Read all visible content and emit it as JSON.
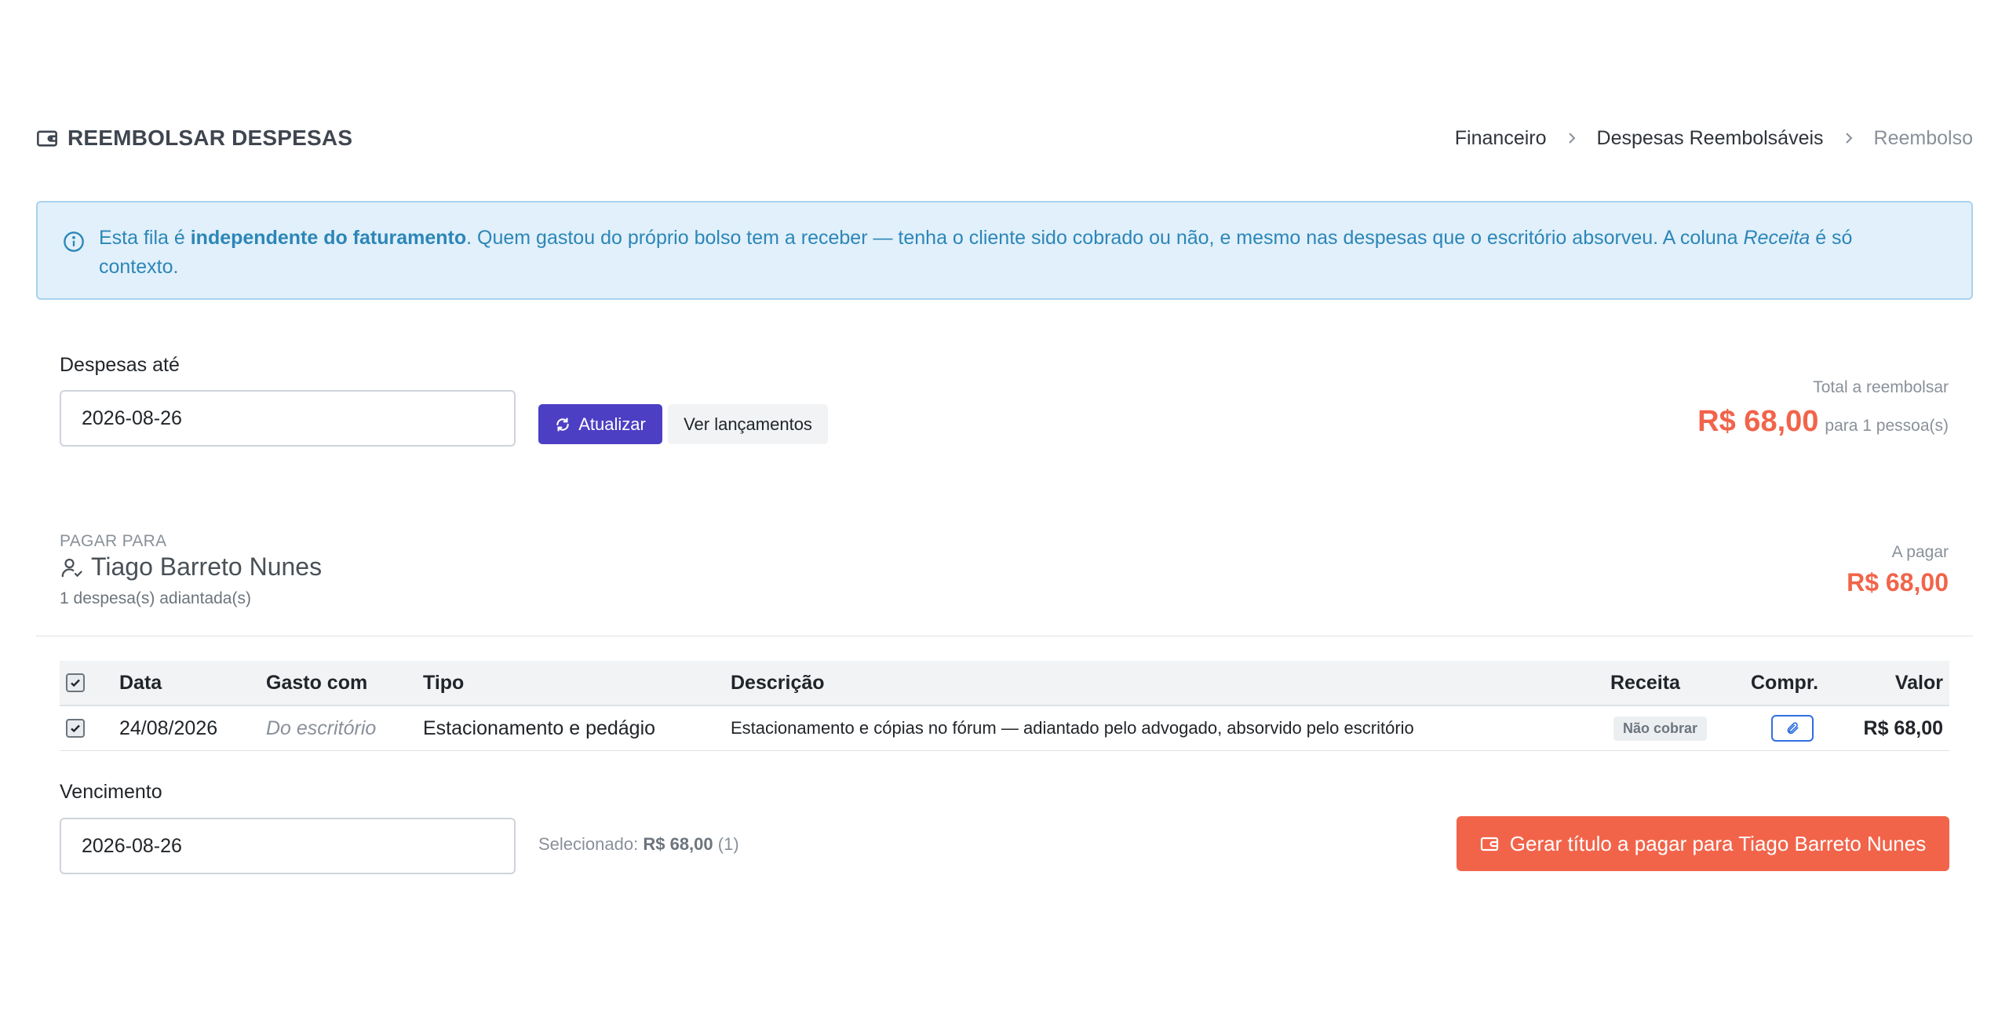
{
  "header": {
    "icon": "wallet-icon",
    "title": "REEMBOLSAR DESPESAS",
    "breadcrumb": [
      "Financeiro",
      "Despesas Reembolsáveis",
      "Reembolso"
    ]
  },
  "alert": {
    "icon": "info-icon",
    "text_1": "Esta fila é ",
    "strong": "independente do faturamento",
    "text_2": ". Quem gastou do próprio bolso tem a receber — tenha o cliente sido cobrado ou não, e mesmo nas despesas que o escritório absorveu. A coluna ",
    "em": "Receita",
    "text_3": " é só contexto."
  },
  "filter": {
    "label": "Despesas até",
    "date_value": "2026-08-26",
    "refresh_label": "Atualizar",
    "view_label": "Ver lançamentos"
  },
  "summary": {
    "total_label": "Total a reembolsar",
    "total_value": "R$ 68,00",
    "people_text": "para 1 pessoa(s)"
  },
  "payee": {
    "pay_to_label": "PAGAR PARA",
    "name": "Tiago Barreto Nunes",
    "count_text": "1 despesa(s) adiantada(s)",
    "to_pay_label": "A pagar",
    "to_pay_value": "R$ 68,00"
  },
  "table": {
    "columns": {
      "data": "Data",
      "gasto_com": "Gasto com",
      "tipo": "Tipo",
      "descricao": "Descrição",
      "receita": "Receita",
      "compr": "Compr.",
      "valor": "Valor"
    },
    "header_checked": true,
    "rows": [
      {
        "checked": true,
        "data": "24/08/2026",
        "gasto_com": "Do escritório",
        "tipo": "Estacionamento e pedágio",
        "descricao": "Estacionamento e cópias no fórum — adiantado pelo advogado, absorvido pelo escritório",
        "receita": "Não cobrar",
        "compr_icon": "paperclip-icon",
        "valor": "R$ 68,00"
      }
    ]
  },
  "footer": {
    "due_label": "Vencimento",
    "due_value": "2026-08-26",
    "selected_label": "Selecionado:",
    "selected_value": "R$ 68,00",
    "selected_count": "(1)",
    "generate_label": "Gerar título a pagar para Tiago Barreto Nunes"
  },
  "colors": {
    "accent": "#4d3fc4",
    "danger": "#f1644a",
    "info_bg": "#e1f0fa",
    "info_text": "#2c86b8"
  }
}
